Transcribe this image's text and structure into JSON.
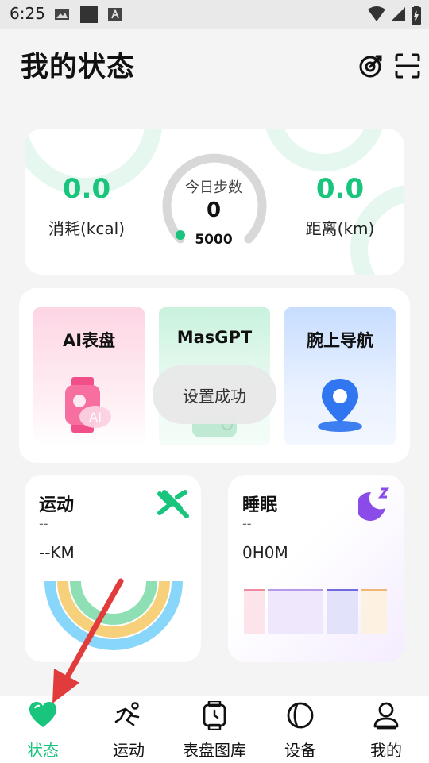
{
  "status_bar": {
    "time": "6:25"
  },
  "header": {
    "title": "我的状态"
  },
  "summary": {
    "calories_value": "0.0",
    "calories_label": "消耗(kcal)",
    "steps_title": "今日步数",
    "steps_value": "0",
    "steps_goal": "5000",
    "distance_value": "0.0",
    "distance_label": "距离(km)"
  },
  "features": [
    {
      "label": "AI表盘",
      "icon": "ai-watch-icon"
    },
    {
      "label": "MasGPT",
      "icon": "chat-icon"
    },
    {
      "label": "腕上导航",
      "icon": "map-pin-icon"
    }
  ],
  "toast": {
    "message": "设置成功"
  },
  "sport": {
    "title": "运动",
    "subtitle": "--",
    "distance": "--KM",
    "icon": "running-icon"
  },
  "sleep": {
    "title": "睡眠",
    "subtitle": "--",
    "duration": "0H0M",
    "icon": "moon-icon"
  },
  "nav": [
    {
      "label": "状态",
      "icon": "heart-icon",
      "active": true
    },
    {
      "label": "运动",
      "icon": "running-icon",
      "active": false
    },
    {
      "label": "表盘图库",
      "icon": "watch-icon",
      "active": false
    },
    {
      "label": "设备",
      "icon": "device-icon",
      "active": false
    },
    {
      "label": "我的",
      "icon": "profile-icon",
      "active": false
    }
  ],
  "colors": {
    "accent": "#19c47d",
    "sleep_purple": "#8a4be8",
    "arrow": "#e23b3b"
  }
}
